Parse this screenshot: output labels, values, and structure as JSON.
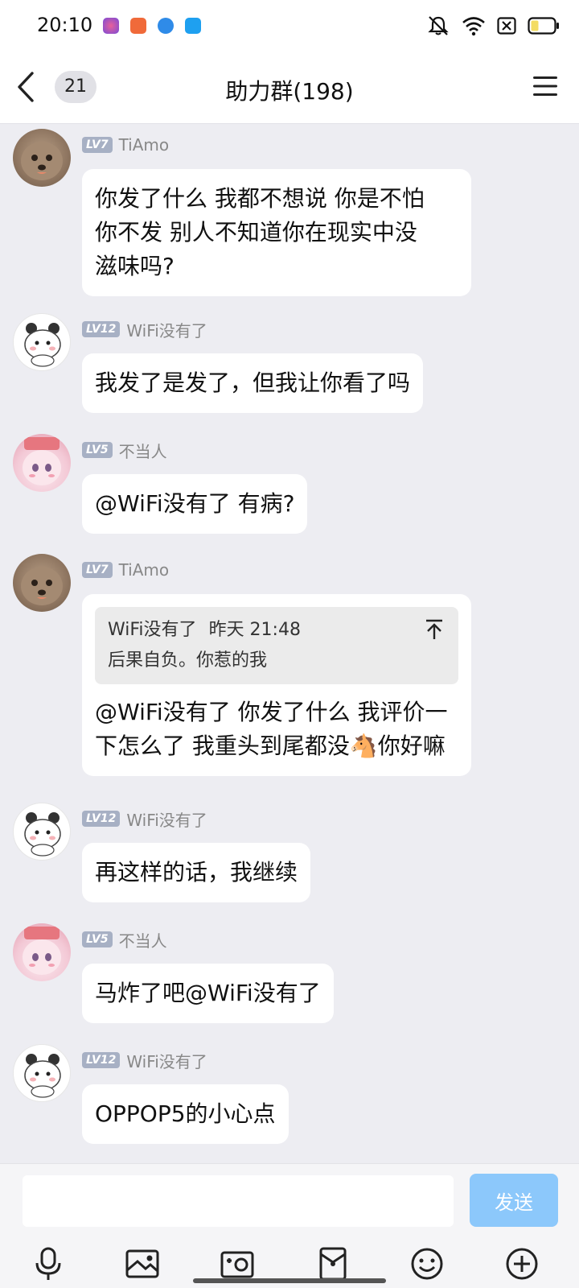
{
  "status_bar": {
    "time": "20:10"
  },
  "header": {
    "back_count": "21",
    "title": "助力群(198)"
  },
  "messages": [
    {
      "level": "LV7",
      "sender": "TiAmo",
      "text_lines": [
        "你发了什么 我都不想说 你是不怕",
        "你不发 别人不知道你在现实中没",
        "滋味吗?"
      ]
    },
    {
      "level": "LV12",
      "sender": "WiFi没有了",
      "text": "我发了是发了，但我让你看了吗"
    },
    {
      "level": "LV5",
      "sender": "不当人",
      "text": "@WiFi没有了 有病?"
    },
    {
      "level": "LV7",
      "sender": "TiAmo",
      "quote": {
        "sender": "WiFi没有了",
        "time": "昨天 21:48",
        "text": "后果自负。你惹的我"
      },
      "text_lines": [
        "@WiFi没有了 你发了什么 我评价一",
        "下怎么了 我重头到尾都没🐴你好嘛"
      ]
    },
    {
      "level": "LV12",
      "sender": "WiFi没有了",
      "text": "再这样的话，我继续"
    },
    {
      "level": "LV5",
      "sender": "不当人",
      "text": "马炸了吧@WiFi没有了"
    },
    {
      "level": "LV12",
      "sender": "WiFi没有了",
      "text": "OPPOP5的小心点"
    }
  ],
  "input": {
    "placeholder": "",
    "send_label": "发送"
  },
  "colors": {
    "send_button": "#8cc8fb",
    "chat_background": "#ededf2",
    "level_badge": "#a7b0c4"
  }
}
